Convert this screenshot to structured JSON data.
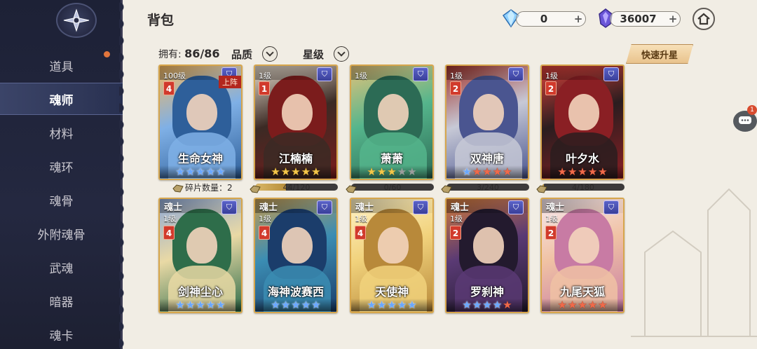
{
  "sidebar": {
    "items": [
      {
        "label": "道具"
      },
      {
        "label": "魂师"
      },
      {
        "label": "材料"
      },
      {
        "label": "魂环"
      },
      {
        "label": "魂骨"
      },
      {
        "label": "外附魂骨"
      },
      {
        "label": "武魂"
      },
      {
        "label": "暗器"
      },
      {
        "label": "魂卡"
      }
    ],
    "active_index": 1
  },
  "header": {
    "title": "背包",
    "currency_diamond": "0",
    "currency_crystal": "36007"
  },
  "filters": {
    "owned_label": "拥有:",
    "owned_count": "86/86",
    "quality_label": "品质",
    "star_label": "星级",
    "upgrade_button": "快速升星"
  },
  "cards_row1": [
    {
      "name": "生命女神",
      "level": "100级",
      "star_num": "4",
      "rank": "",
      "deployed": "上阵",
      "stars": [
        "blue",
        "blue",
        "blue",
        "blue",
        "blue"
      ],
      "progress_text": "碎片数量：2",
      "progress": null
    },
    {
      "name": "江楠楠",
      "level": "1级",
      "star_num": "1",
      "rank": "",
      "deployed": "",
      "stars": [
        "gold",
        "gold",
        "gold",
        "gold",
        "gold"
      ],
      "progress_text": "44/120",
      "progress": 0.37
    },
    {
      "name": "萧萧",
      "level": "1级",
      "star_num": "",
      "rank": "",
      "deployed": "",
      "stars": [
        "gold",
        "gold",
        "gold",
        "grey",
        "grey"
      ],
      "progress_text": "0/60",
      "progress": 0.0
    },
    {
      "name": "双神唐",
      "level": "1级",
      "star_num": "2",
      "rank": "",
      "deployed": "",
      "stars": [
        "blue",
        "red",
        "red",
        "red",
        "red"
      ],
      "progress_text": "3/240",
      "progress": 0.0125
    },
    {
      "name": "叶夕水",
      "level": "1级",
      "star_num": "2",
      "rank": "",
      "deployed": "",
      "stars": [
        "red",
        "red",
        "red",
        "red",
        "red"
      ],
      "progress_text": "4/180",
      "progress": 0.022
    }
  ],
  "cards_row2": [
    {
      "name": "剑神尘心",
      "level": "1级",
      "star_num": "4",
      "rank": "魂士",
      "deployed": "",
      "stars": [
        "blue",
        "blue",
        "blue",
        "blue",
        "blue"
      ]
    },
    {
      "name": "海神波赛西",
      "level": "1级",
      "star_num": "4",
      "rank": "魂士",
      "deployed": "",
      "stars": [
        "blue",
        "blue",
        "blue",
        "blue",
        "blue"
      ]
    },
    {
      "name": "天使神",
      "level": "1级",
      "star_num": "4",
      "rank": "魂士",
      "deployed": "",
      "stars": [
        "blue",
        "blue",
        "blue",
        "blue",
        "blue"
      ]
    },
    {
      "name": "罗刹神",
      "level": "1级",
      "star_num": "2",
      "rank": "魂士",
      "deployed": "",
      "stars": [
        "blue",
        "blue",
        "blue",
        "blue",
        "red"
      ]
    },
    {
      "name": "九尾天狐",
      "level": "1级",
      "star_num": "2",
      "rank": "魂士",
      "deployed": "",
      "stars": [
        "red",
        "red",
        "red",
        "red",
        "red"
      ]
    }
  ],
  "chat_badge": "1",
  "colors": {
    "sidebar_bg": "#1d2136",
    "card_border": "#d7a64c",
    "accent_red": "#d13a2c"
  }
}
